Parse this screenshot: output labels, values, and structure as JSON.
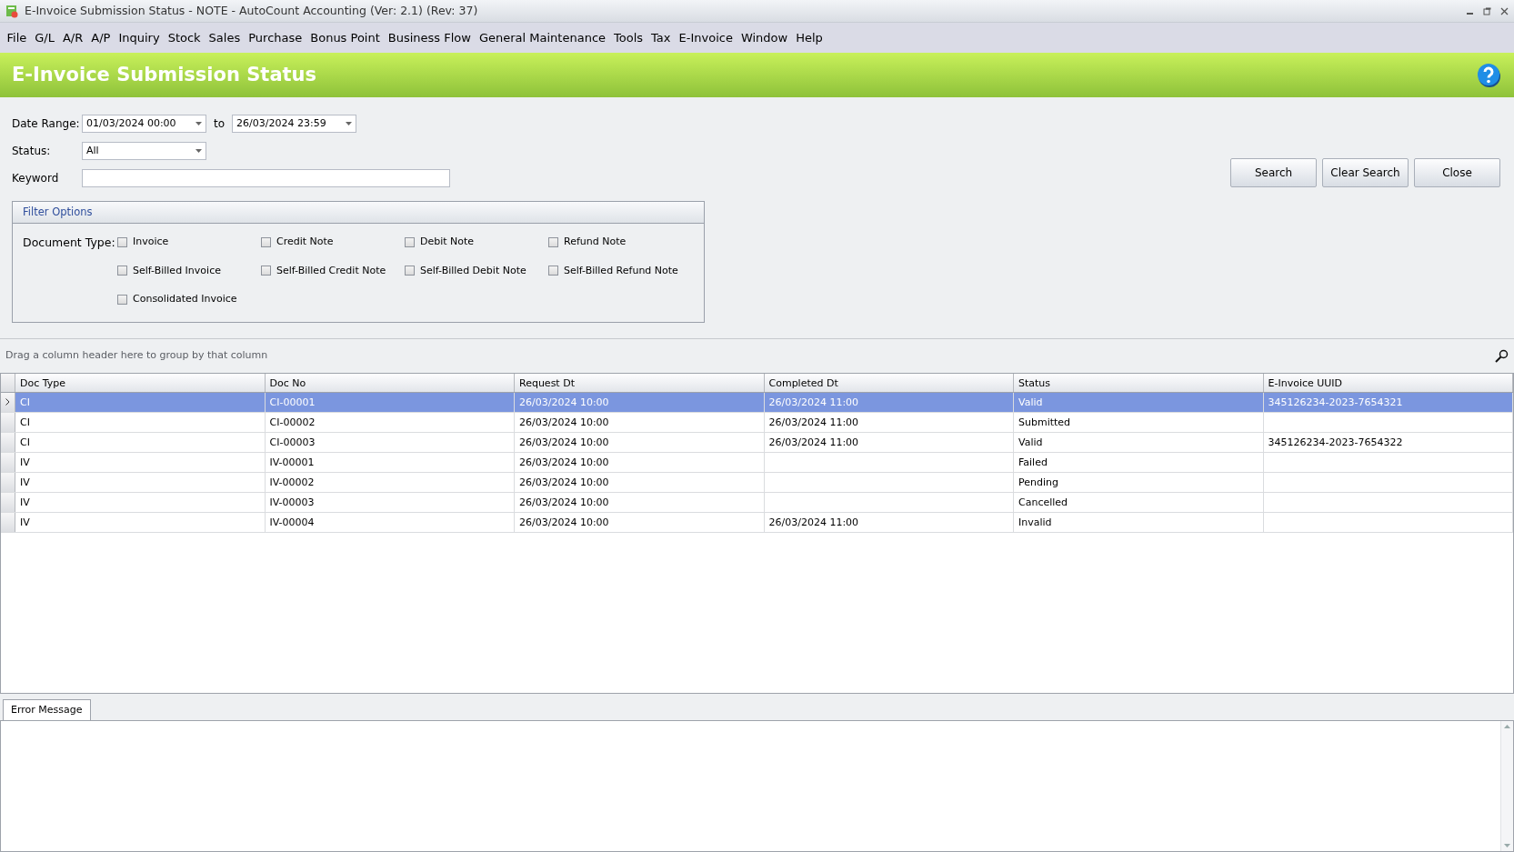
{
  "window": {
    "title": "E-Invoice Submission Status - NOTE - AutoCount Accounting (Ver: 2.1) (Rev: 37)"
  },
  "menu": [
    "File",
    "G/L",
    "A/R",
    "A/P",
    "Inquiry",
    "Stock",
    "Sales",
    "Purchase",
    "Bonus Point",
    "Business Flow",
    "General Maintenance",
    "Tools",
    "Tax",
    "E-Invoice",
    "Window",
    "Help"
  ],
  "header": {
    "title": "E-Invoice Submission Status"
  },
  "form": {
    "date_range_label": "Date Range:",
    "date_from": "01/03/2024 00:00",
    "to_label": "to",
    "date_to": "26/03/2024 23:59",
    "status_label": "Status:",
    "status": "All",
    "keyword_label": "Keyword"
  },
  "buttons": [
    "Search",
    "Clear Search",
    "Close"
  ],
  "filter_options": {
    "title": "Filter Options",
    "label": "Document Type:",
    "types": [
      {
        "label": "Invoice",
        "checked": false
      },
      {
        "label": "Credit Note",
        "checked": false
      },
      {
        "label": "Debit Note",
        "checked": false
      },
      {
        "label": "Refund Note",
        "checked": false
      },
      {
        "label": "Self-Billed Invoice",
        "checked": false
      },
      {
        "label": "Self-Billed Credit Note",
        "checked": false
      },
      {
        "label": "Self-Billed Debit Note",
        "checked": false
      },
      {
        "label": "Self-Billed Refund Note",
        "checked": false
      },
      {
        "label": "Consolidated Invoice",
        "checked": false
      }
    ]
  },
  "grid": {
    "group_hint": "Drag a column header here to group by that column",
    "columns": [
      "Doc Type",
      "Doc No",
      "Request Dt",
      "Completed Dt",
      "Status",
      "E-Invoice UUID"
    ],
    "rows": [
      {
        "selected": true,
        "cells": [
          "CI",
          "CI-00001",
          "26/03/2024 10:00",
          "26/03/2024 11:00",
          "Valid",
          "345126234-2023-7654321"
        ]
      },
      {
        "selected": false,
        "cells": [
          "CI",
          "CI-00002",
          "26/03/2024 10:00",
          "26/03/2024 11:00",
          "Submitted",
          ""
        ]
      },
      {
        "selected": false,
        "cells": [
          "CI",
          "CI-00003",
          "26/03/2024 10:00",
          "26/03/2024 11:00",
          "Valid",
          "345126234-2023-7654322"
        ]
      },
      {
        "selected": false,
        "cells": [
          "IV",
          "IV-00001",
          "26/03/2024 10:00",
          "",
          "Failed",
          ""
        ]
      },
      {
        "selected": false,
        "cells": [
          "IV",
          "IV-00002",
          "26/03/2024 10:00",
          "",
          "Pending",
          ""
        ]
      },
      {
        "selected": false,
        "cells": [
          "IV",
          "IV-00003",
          "26/03/2024 10:00",
          "",
          "Cancelled",
          ""
        ]
      },
      {
        "selected": false,
        "cells": [
          "IV",
          "IV-00004",
          "26/03/2024 10:00",
          "26/03/2024 11:00",
          "Invalid",
          ""
        ]
      }
    ]
  },
  "bottom_tabs": [
    {
      "label": "Error Message",
      "selected": true
    }
  ]
}
